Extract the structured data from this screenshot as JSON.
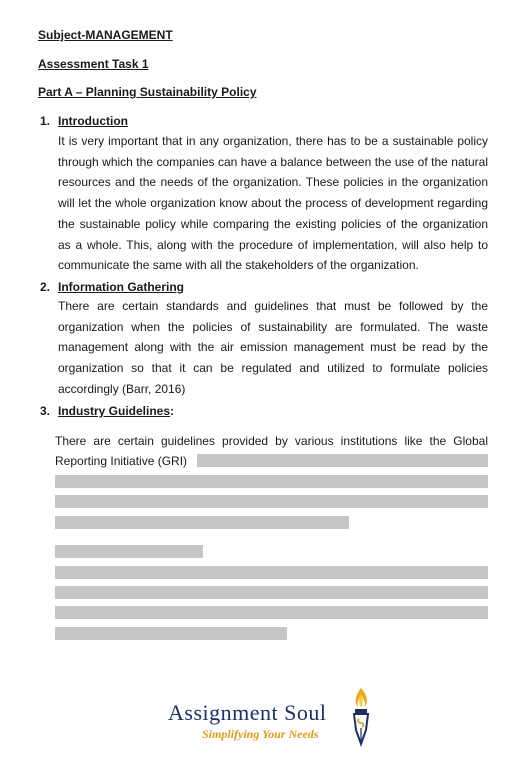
{
  "header": {
    "subject": "Subject-MANAGEMENT",
    "task": "Assessment Task 1",
    "part": "Part A – Planning Sustainability Policy"
  },
  "sections": [
    {
      "number": "1.",
      "title": "Introduction",
      "body": "It is very important that in any organization, there has to be a sustainable policy through which the companies can have a balance between the use of the natural resources and the needs of the organization. These policies in the organization will let the whole organization know about the process of development regarding the sustainable policy while comparing the existing policies of the organization as a whole. This, along with the procedure of implementation, will also help to communicate the same with all the stakeholders of the organization."
    },
    {
      "number": "2.",
      "title": "Information Gathering",
      "body": "There are certain standards and guidelines that must be followed by the organization when the policies of sustainability are formulated. The waste management along with the air emission management must be read by the organization so that it can be regulated and utilized to formulate policies accordingly (Barr, 2016)"
    },
    {
      "number": "3.",
      "title": "Industry Guidelines",
      "title_suffix": ":",
      "body": "There are certain guidelines provided by various institutions like the Global Reporting Initiative (GRI)"
    }
  ],
  "footer": {
    "logo_text": "Assignment Soul",
    "tagline": "Simplifying Your Needs",
    "colors": {
      "navy": "#1d2f63",
      "gold": "#e19a20"
    }
  }
}
